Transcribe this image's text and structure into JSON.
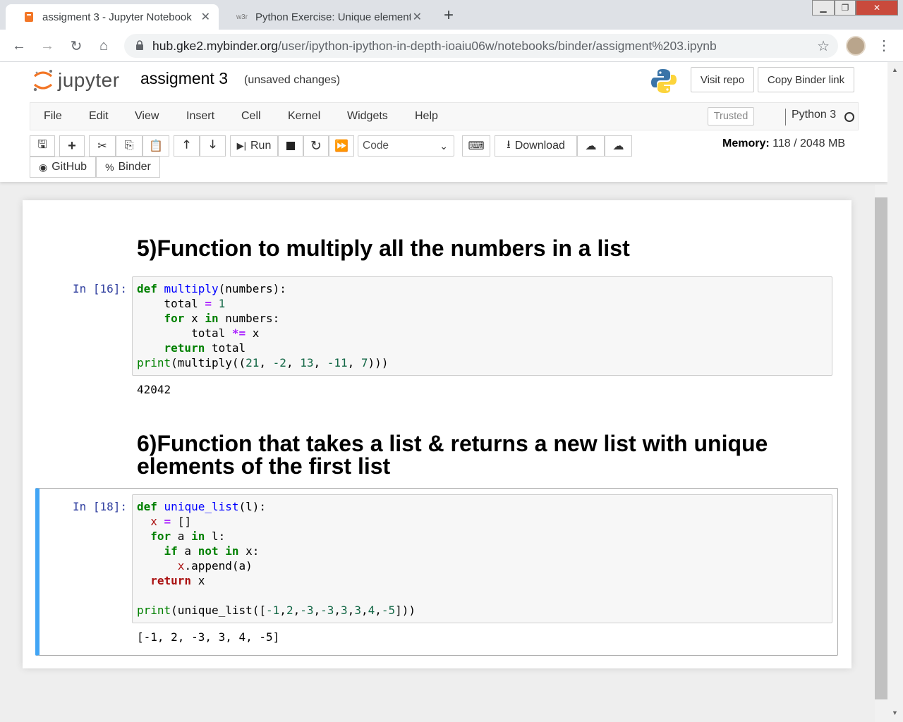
{
  "browser": {
    "tabs": [
      {
        "title": "assigment 3 - Jupyter Notebook",
        "active": true,
        "icon": "jupyter-favicon"
      },
      {
        "title": "Python Exercise: Unique element",
        "active": false,
        "icon": "w3r-favicon",
        "icon_text": "w3r"
      }
    ],
    "url_host": "hub.gke2.mybinder.org",
    "url_path": "/user/ipython-ipython-in-depth-ioaiu06w/notebooks/binder/assigment%203.ipynb"
  },
  "jupyter": {
    "logo_text": "jupyter",
    "notebook_name": "assigment 3",
    "save_status": "(unsaved changes)",
    "header_buttons": {
      "visit_repo": "Visit repo",
      "copy_binder": "Copy Binder link"
    },
    "menu": [
      "File",
      "Edit",
      "View",
      "Insert",
      "Cell",
      "Kernel",
      "Widgets",
      "Help"
    ],
    "trusted": "Trusted",
    "kernel": "Python 3",
    "toolbar": {
      "run": "Run",
      "cell_type": "Code",
      "download": "Download",
      "github": "GitHub",
      "binder": "Binder"
    },
    "memory": {
      "label": "Memory:",
      "value": "118 / 2048 MB"
    }
  },
  "cells": [
    {
      "type": "markdown",
      "text": "5)Function to multiply all the numbers in a list"
    },
    {
      "type": "code",
      "prompt": "In [16]:",
      "output": "42042"
    },
    {
      "type": "markdown",
      "line1": "6)Function that takes a list & returns a new list with unique",
      "line2": "elements of the first list"
    },
    {
      "type": "code",
      "prompt": "In [18]:",
      "output": "[-1, 2, -3, 3, 4, -5]"
    }
  ],
  "colors": {
    "accent": "#42a5f5",
    "prompt": "#303f9f",
    "jupyter_orange": "#f37626"
  }
}
